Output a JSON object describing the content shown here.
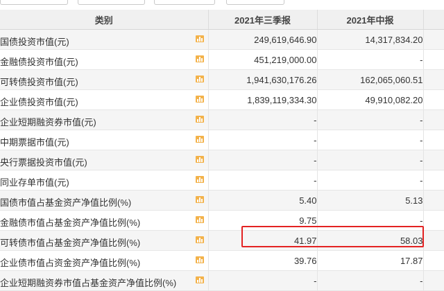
{
  "header": {
    "category": "类别",
    "col1": "2021年三季报",
    "col2": "2021年中报"
  },
  "rows": [
    {
      "label": "国债投资市值(元)",
      "q3": "249,619,646.90",
      "h1": "14,317,834.20"
    },
    {
      "label": "金融债投资市值(元)",
      "q3": "451,219,000.00",
      "h1": "-"
    },
    {
      "label": "可转债投资市值(元)",
      "q3": "1,941,630,176.26",
      "h1": "162,065,060.51"
    },
    {
      "label": "企业债投资市值(元)",
      "q3": "1,839,119,334.30",
      "h1": "49,910,082.20"
    },
    {
      "label": "企业短期融资券市值(元)",
      "q3": "-",
      "h1": "-"
    },
    {
      "label": "中期票据市值(元)",
      "q3": "-",
      "h1": "-"
    },
    {
      "label": "央行票据投资市值(元)",
      "q3": "-",
      "h1": "-"
    },
    {
      "label": "同业存单市值(元)",
      "q3": "-",
      "h1": "-"
    },
    {
      "label": "国债市值占基金资产净值比例(%)",
      "q3": "5.40",
      "h1": "5.13"
    },
    {
      "label": "金融债市值占基金资产净值比例(%)",
      "q3": "9.75",
      "h1": "-"
    },
    {
      "label": "可转债市值占基金资产净值比例(%)",
      "q3": "41.97",
      "h1": "58.03"
    },
    {
      "label": "企业债市值占资金资产净值比例(%)",
      "q3": "39.76",
      "h1": "17.87"
    },
    {
      "label": "企业短期融资券市值占基金资产净值比例(%)",
      "q3": "-",
      "h1": "-"
    }
  ],
  "icons": {
    "row_chart": "bar-chart-icon"
  },
  "colors": {
    "highlight": "#e32222",
    "icon": "#f3b24a",
    "header_bg": "#f0f0f0"
  }
}
